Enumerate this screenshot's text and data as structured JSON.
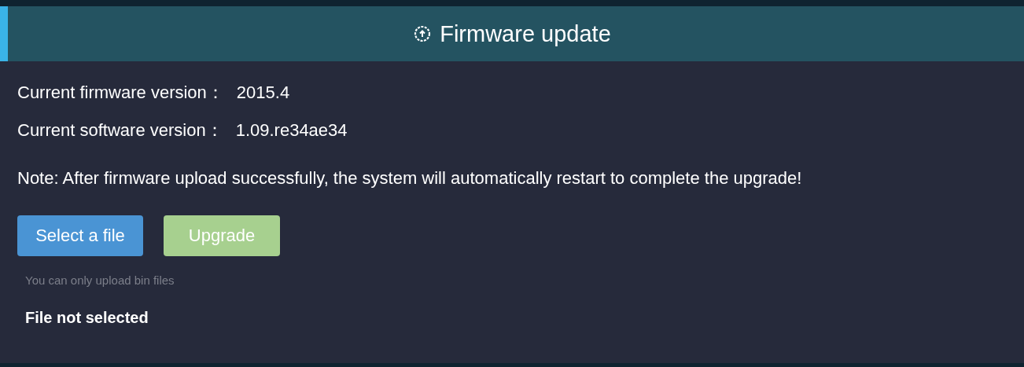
{
  "header": {
    "title": "Firmware update"
  },
  "info": [
    {
      "label": "Current firmware version：",
      "value": "2015.4"
    },
    {
      "label": "Current software version：",
      "value": "1.09.re34ae34"
    }
  ],
  "note": "Note: After firmware upload successfully, the system will automatically restart to complete the upgrade!",
  "buttons": [
    {
      "label": "Select a file",
      "kind": "primary",
      "disabled": false
    },
    {
      "label": "Upgrade",
      "kind": "success",
      "disabled": true
    }
  ],
  "hint": "You can only upload bin files",
  "file_status": "File not selected"
}
